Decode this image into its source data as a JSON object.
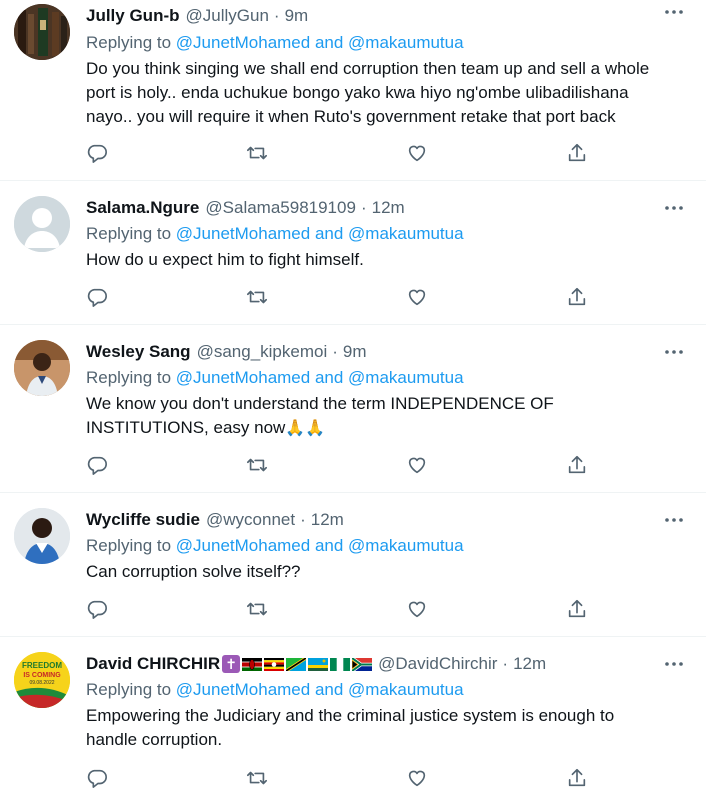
{
  "tweets": [
    {
      "name": "Jully Gun-b",
      "handle": "@JullyGun",
      "time": "9m",
      "replying_prefix": "Replying to ",
      "replying_to": "@JunetMohamed and @makaumutua",
      "text_lines": [
        "Do you think singing we shall end corruption then team up and sell a whole",
        "port is holy.. enda uchukue bongo yako kwa hiyo ng'ombe ulibadilishana",
        "nayo.. you will require it when Ruto's government retake that port back"
      ]
    },
    {
      "name": "Salama.Ngure",
      "handle": "@Salama59819109",
      "time": "12m",
      "replying_prefix": "Replying to ",
      "replying_to": "@JunetMohamed and @makaumutua",
      "text_lines": [
        "How do u expect him to fight himself."
      ]
    },
    {
      "name": "Wesley Sang",
      "handle": "@sang_kipkemoi",
      "time": "9m",
      "replying_prefix": "Replying to ",
      "replying_to": "@JunetMohamed and @makaumutua",
      "text_lines": [
        "We know you don't understand the term INDEPENDENCE OF",
        "INSTITUTIONS, easy now"
      ],
      "text_emoji": "🙏🙏"
    },
    {
      "name": "Wycliffe sudie",
      "handle": "@wyconnet",
      "time": "12m",
      "replying_prefix": "Replying to ",
      "replying_to": "@JunetMohamed and @makaumutua",
      "text_lines": [
        "Can corruption solve itself??"
      ]
    },
    {
      "name": "David CHIRCHIR",
      "handle": "@DavidChirchir",
      "time": "12m",
      "name_symbol": "✝",
      "replying_prefix": "Replying to ",
      "replying_to": "@JunetMohamed and @makaumutua",
      "text_lines": [
        "Empowering the Judiciary and the criminal justice system is enough to",
        "handle corruption."
      ],
      "avatar_text": [
        "FREEDOM",
        "IS COMING",
        "09.08.2022"
      ]
    }
  ],
  "separator": "·",
  "colors": {
    "link": "#1d9bf0",
    "secondary": "#536471",
    "text": "#0f1419",
    "border": "#eff3f4"
  },
  "icons": [
    "more-icon",
    "reply-icon",
    "retweet-icon",
    "like-icon",
    "share-icon",
    "cross-icon",
    "flag-icons"
  ]
}
